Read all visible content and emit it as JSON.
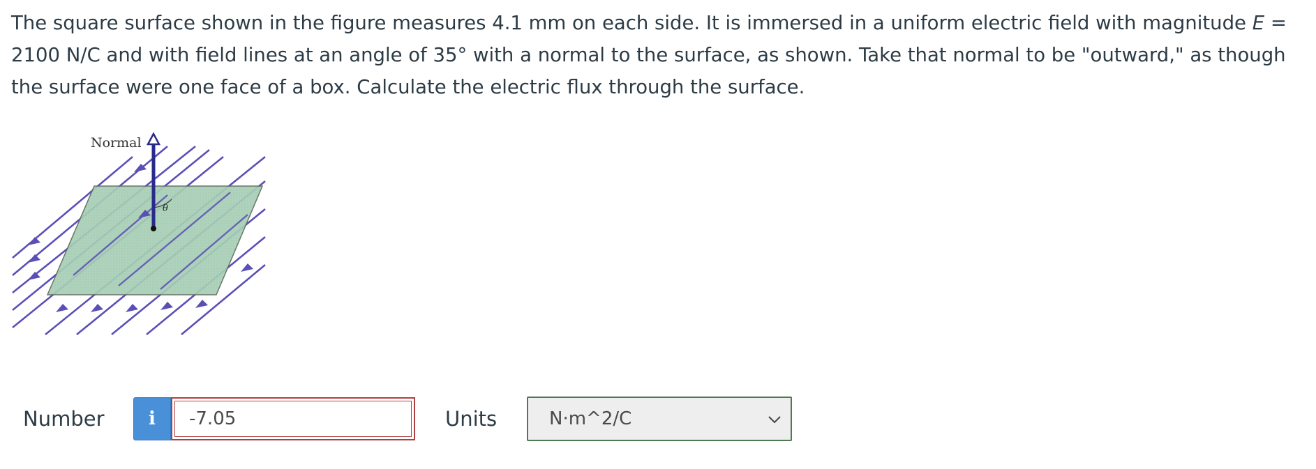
{
  "question": {
    "part1": "The square surface shown in the figure measures 4.1 mm on each side. It is immersed in a uniform electric field with magnitude ",
    "var_E": "E",
    "part2": " = 2100 N/C and with field lines at an angle of 35° with a normal to the surface, as shown. Take that normal to be \"outward,\" as though the surface were one face of a box. Calculate the electric flux through the surface."
  },
  "figure": {
    "normal_label": "Normal",
    "theta_label": "θ"
  },
  "answer": {
    "number_label": "Number",
    "info_icon_label": "i",
    "number_value": "-7.05",
    "units_label": "Units",
    "units_value": "N·m^2/C"
  },
  "colors": {
    "surface_fill": "#a8cfb6",
    "field_line": "#5a4fb5",
    "normal_arrow": "#2a2a8a",
    "input_border": "#b0403f",
    "info_button": "#4a90d9",
    "select_border": "#4f7a4f"
  },
  "icons": {
    "info": "info-icon",
    "dropdown": "chevron-down-icon"
  }
}
